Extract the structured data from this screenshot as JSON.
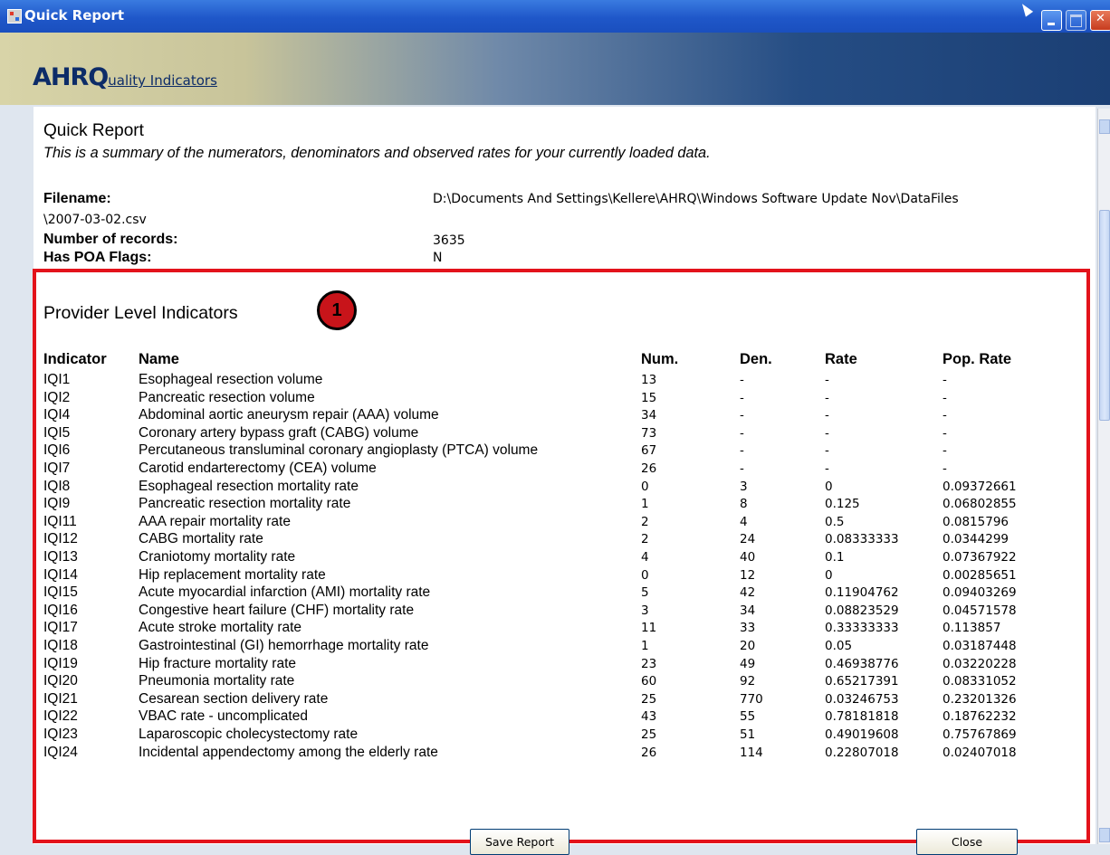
{
  "window": {
    "title": "Quick Report"
  },
  "banner": {
    "logo_main": "AHRQ",
    "logo_sub": "uality Indicators"
  },
  "report": {
    "title": "Quick Report",
    "subtitle": "This is a summary of the numerators, denominators and observed rates for your currently loaded data.",
    "filename_label": "Filename:",
    "filename_value": "D:\\Documents And Settings\\Kellere\\AHRQ\\Windows Software Update Nov\\DataFiles",
    "filename_value_cont": "\\2007-03-02.csv",
    "records_label": "Number of records:",
    "records_value": "3635",
    "poa_label": "Has POA Flags:",
    "poa_value": "N"
  },
  "section": {
    "title": "Provider Level Indicators",
    "marker": "1"
  },
  "table": {
    "headers": {
      "indicator": "Indicator",
      "name": "Name",
      "num": "Num.",
      "den": "Den.",
      "rate": "Rate",
      "pop_rate": "Pop. Rate"
    },
    "rows": [
      {
        "indicator": "IQI1",
        "name": "Esophageal resection volume",
        "num": "13",
        "den": "-",
        "rate": "-",
        "pop_rate": "-"
      },
      {
        "indicator": "IQI2",
        "name": "Pancreatic resection volume",
        "num": "15",
        "den": "-",
        "rate": "-",
        "pop_rate": "-"
      },
      {
        "indicator": "IQI4",
        "name": "Abdominal aortic aneurysm repair (AAA) volume",
        "num": "34",
        "den": "-",
        "rate": "-",
        "pop_rate": "-"
      },
      {
        "indicator": "IQI5",
        "name": "Coronary artery bypass graft (CABG) volume",
        "num": "73",
        "den": "-",
        "rate": "-",
        "pop_rate": "-"
      },
      {
        "indicator": "IQI6",
        "name": "Percutaneous transluminal coronary angioplasty (PTCA) volume",
        "num": "67",
        "den": "-",
        "rate": "-",
        "pop_rate": "-"
      },
      {
        "indicator": "IQI7",
        "name": "Carotid endarterectomy (CEA) volume",
        "num": "26",
        "den": "-",
        "rate": "-",
        "pop_rate": "-"
      },
      {
        "indicator": "IQI8",
        "name": "Esophageal resection mortality rate",
        "num": "0",
        "den": "3",
        "rate": "0",
        "pop_rate": "0.09372661"
      },
      {
        "indicator": "IQI9",
        "name": "Pancreatic resection mortality rate",
        "num": "1",
        "den": "8",
        "rate": "0.125",
        "pop_rate": "0.06802855"
      },
      {
        "indicator": "IQI11",
        "name": "AAA repair mortality rate",
        "num": "2",
        "den": "4",
        "rate": "0.5",
        "pop_rate": "0.0815796"
      },
      {
        "indicator": "IQI12",
        "name": "CABG mortality rate",
        "num": "2",
        "den": "24",
        "rate": "0.08333333",
        "pop_rate": "0.0344299"
      },
      {
        "indicator": "IQI13",
        "name": "Craniotomy mortality rate",
        "num": "4",
        "den": "40",
        "rate": "0.1",
        "pop_rate": "0.07367922"
      },
      {
        "indicator": "IQI14",
        "name": "Hip replacement mortality rate",
        "num": "0",
        "den": "12",
        "rate": "0",
        "pop_rate": "0.00285651"
      },
      {
        "indicator": "IQI15",
        "name": "Acute myocardial infarction (AMI) mortality rate",
        "num": "5",
        "den": "42",
        "rate": "0.11904762",
        "pop_rate": "0.09403269"
      },
      {
        "indicator": "IQI16",
        "name": "Congestive heart failure (CHF) mortality rate",
        "num": "3",
        "den": "34",
        "rate": "0.08823529",
        "pop_rate": "0.04571578"
      },
      {
        "indicator": "IQI17",
        "name": "Acute stroke mortality rate",
        "num": "11",
        "den": "33",
        "rate": "0.33333333",
        "pop_rate": "0.113857"
      },
      {
        "indicator": "IQI18",
        "name": "Gastrointestinal (GI) hemorrhage mortality rate",
        "num": "1",
        "den": "20",
        "rate": "0.05",
        "pop_rate": "0.03187448"
      },
      {
        "indicator": "IQI19",
        "name": "Hip fracture mortality rate",
        "num": "23",
        "den": "49",
        "rate": "0.46938776",
        "pop_rate": "0.03220228"
      },
      {
        "indicator": "IQI20",
        "name": "Pneumonia mortality rate",
        "num": "60",
        "den": "92",
        "rate": "0.65217391",
        "pop_rate": "0.08331052"
      },
      {
        "indicator": "IQI21",
        "name": "Cesarean section delivery rate",
        "num": "25",
        "den": "770",
        "rate": "0.03246753",
        "pop_rate": "0.23201326"
      },
      {
        "indicator": "IQI22",
        "name": "VBAC rate - uncomplicated",
        "num": "43",
        "den": "55",
        "rate": "0.78181818",
        "pop_rate": "0.18762232"
      },
      {
        "indicator": "IQI23",
        "name": "Laparoscopic cholecystectomy rate",
        "num": "25",
        "den": "51",
        "rate": "0.49019608",
        "pop_rate": "0.75767869"
      },
      {
        "indicator": "IQI24",
        "name": "Incidental appendectomy among the elderly rate",
        "num": "26",
        "den": "114",
        "rate": "0.22807018",
        "pop_rate": "0.02407018"
      }
    ]
  },
  "buttons": {
    "save": "Save Report",
    "close": "Close"
  }
}
